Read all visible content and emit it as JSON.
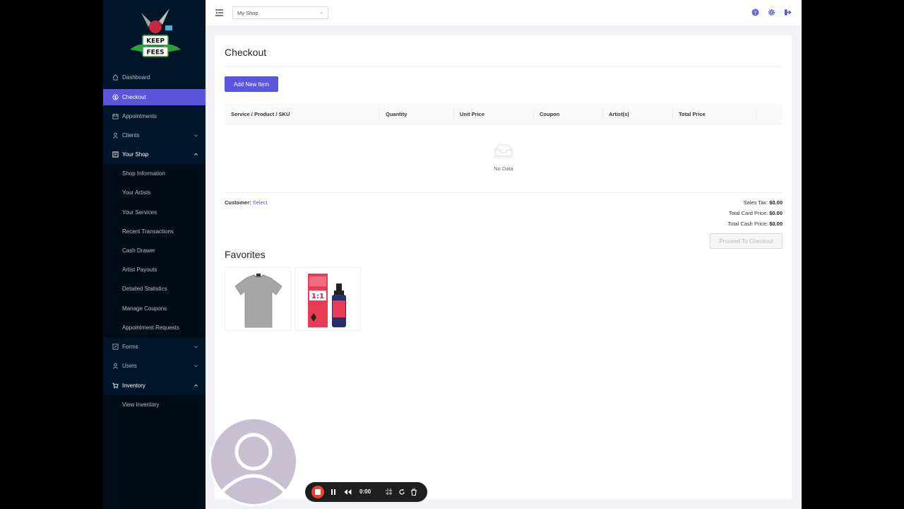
{
  "header": {
    "shop_select_value": "My Shop"
  },
  "sidebar": {
    "items": [
      {
        "label": "Dashboard",
        "icon": "home-icon"
      },
      {
        "label": "Checkout",
        "icon": "dollar-circle-icon",
        "active": true
      },
      {
        "label": "Appointments",
        "icon": "calendar-icon"
      },
      {
        "label": "Clients",
        "icon": "user-icon"
      },
      {
        "label": "Your Shop",
        "icon": "shop-icon",
        "open": true
      },
      {
        "label": "Shop Information"
      },
      {
        "label": "Your Artists"
      },
      {
        "label": "Your Services"
      },
      {
        "label": "Recent Transactions"
      },
      {
        "label": "Cash Drawer"
      },
      {
        "label": "Artist Payouts"
      },
      {
        "label": "Detailed Statistics"
      },
      {
        "label": "Manage Coupons"
      },
      {
        "label": "Appointment Requests"
      },
      {
        "label": "Forms",
        "icon": "form-icon"
      },
      {
        "label": "Users",
        "icon": "user-icon"
      },
      {
        "label": "Inventory",
        "icon": "cart-icon",
        "open": true
      },
      {
        "label": "View Inventory"
      }
    ]
  },
  "main": {
    "title": "Checkout",
    "add_button": "Add New Item",
    "table": {
      "columns": [
        "Service / Product / SKU",
        "Quantity",
        "Unit Price",
        "Coupon",
        "Artist(s)",
        "Total Price"
      ],
      "empty_text": "No Data"
    },
    "customer_label": "Customer:",
    "customer_link": "Select",
    "totals": {
      "sales_tax_label": "Sales Tax:",
      "sales_tax": "$0.00",
      "card_label": "Total Card Price:",
      "card": "$0.00",
      "cash_label": "Total Cash Price:",
      "cash": "$0.00"
    },
    "checkout_button": "Proceed To Checkout",
    "favorites_title": "Favorites"
  },
  "recorder": {
    "time": "0:00"
  },
  "colors": {
    "accent": "#5b56e0",
    "sidebar_bg": "#001529",
    "record_red": "#e8442e"
  }
}
